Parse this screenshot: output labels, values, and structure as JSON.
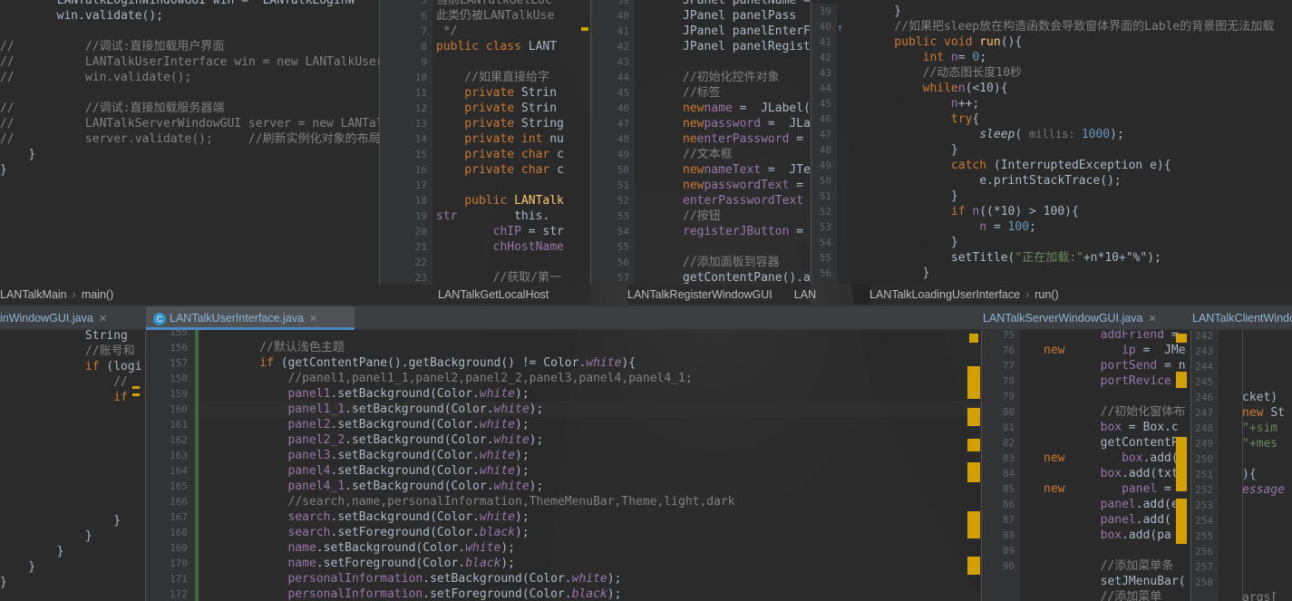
{
  "colors": {
    "bg": "#2b2b2b",
    "keyword": "#cc7832",
    "string": "#6a8759",
    "comment": "#808080",
    "field": "#9876aa",
    "number": "#6897bb",
    "method": "#ffc66d",
    "text": "#a9b7c6"
  },
  "pane1": {
    "lines": [
      {
        "pre": "        ",
        "c": "LANTalkLoginWindowGUI win = ",
        "k": "new",
        "r": " LANTalkLoginW"
      },
      {
        "pre": "        ",
        "c": "win.validate();"
      },
      {
        "pre": "",
        "c": ""
      },
      {
        "cm": "//          //调试:直接加载用户界面"
      },
      {
        "cm": "//          LANTalkUserInterface win = new LANTalkUserI"
      },
      {
        "cm": "//          win.validate();"
      },
      {
        "pre": "",
        "c": ""
      },
      {
        "cm": "//          //调试:直接加载服务器端"
      },
      {
        "cm": "//          LANTalkServerWindowGUI server = new LANTalk"
      },
      {
        "cm": "//          server.validate();     //刷新实例化对象的布局"
      },
      {
        "pre": "    ",
        "c": "}"
      },
      {
        "pre": "",
        "c": "}"
      }
    ],
    "crumb": [
      "LANTalkMain",
      "main()"
    ]
  },
  "pane2": {
    "numbers": [
      "5",
      "6",
      "7",
      "8",
      "9",
      "10",
      "11",
      "12",
      "13",
      "14",
      "15",
      "16",
      "17",
      "18",
      "19",
      "20",
      "21",
      "22",
      "23"
    ],
    "lines": [
      {
        "cm": "当前LANTalkGetLoc"
      },
      {
        "cm": "此类仍被LANTalkUse"
      },
      {
        "cm": " */"
      },
      {
        "kw": "public class ",
        "c": "LANT"
      },
      {
        "c": ""
      },
      {
        "cm": "    //如果直接给字"
      },
      {
        "kw": "    private ",
        "c": "Strin"
      },
      {
        "kw": "    private ",
        "c": "Strin"
      },
      {
        "kw": "    private ",
        "c": "String"
      },
      {
        "kw": "    private int ",
        "c": "nu"
      },
      {
        "kw": "    private char ",
        "c": "c"
      },
      {
        "kw": "    private char ",
        "c": "c"
      },
      {
        "c": ""
      },
      {
        "kw": "    public ",
        "fn": "LANTalk"
      },
      {
        "c": "        this.",
        "fld": "str"
      },
      {
        "fld": "        chIP",
        "c": " = str"
      },
      {
        "fld": "        chHostName"
      },
      {
        "c": ""
      },
      {
        "cm": "        //获取/第一"
      }
    ],
    "crumb": [
      "LANTalkGetLocalHost"
    ]
  },
  "pane3": {
    "numbers": [
      "39",
      "40",
      "41",
      "42",
      "43",
      "44",
      "45",
      "46",
      "47",
      "48",
      "49",
      "50",
      "51",
      "52",
      "53",
      "54",
      "55",
      "56",
      "57"
    ],
    "lines": [
      {
        "c": "JPanel panelName = "
      },
      {
        "c": "JPanel panelPass"
      },
      {
        "c": "JPanel panelEnterF"
      },
      {
        "c": "JPanel panelRegist"
      },
      {
        "c": ""
      },
      {
        "cm": "//初始化控件对象"
      },
      {
        "cm": "//标签"
      },
      {
        "fld": "name",
        "c": " = ",
        "kw": "new",
        "r": " JLabel("
      },
      {
        "fld": "password",
        "c": " = ",
        "kw": "new",
        "r": " JLa"
      },
      {
        "fld": "enterPassword",
        "c": " = ",
        "kw": "ne"
      },
      {
        "cm": "//文本框"
      },
      {
        "fld": "nameText",
        "c": " = ",
        "kw": "new",
        "r": " JTe"
      },
      {
        "fld": "passwordText",
        "c": " = ",
        "kw": "new"
      },
      {
        "fld": "enterPasswordText"
      },
      {
        "cm": "//按钮"
      },
      {
        "fld": "registerJButton",
        "c": " = "
      },
      {
        "c": ""
      },
      {
        "cm": "//添加面板到容器"
      },
      {
        "c": "getContentPane().a"
      }
    ],
    "crumb": [
      "LANTalkRegisterWindowGUI",
      "LAN"
    ]
  },
  "pane4": {
    "numbers": [
      "39",
      "40",
      "41",
      "42",
      "43",
      "44",
      "45",
      "46",
      "47",
      "48",
      "49",
      "50",
      "51",
      "52",
      "53",
      "54",
      "55",
      "56"
    ],
    "lines": [
      {
        "c": "    }"
      },
      {
        "cm": "    //如果把sleep放在构造函数会导致窗体界面的Lable的背景图无法加载"
      },
      {
        "kw": "    public void ",
        "fn": "run",
        "c": "(){"
      },
      {
        "kw": "        int ",
        "fld": "n",
        "c": "= ",
        "num": "0",
        "e": ";"
      },
      {
        "cm": "        //动态图长度10秒"
      },
      {
        "kw": "        while",
        "c": "(",
        "fld": "n",
        "e": "<10){"
      },
      {
        "fld": "            n",
        "c": "++;"
      },
      {
        "kw": "            try",
        "c": "{"
      },
      {
        "it": "                sleep",
        "c": "( ",
        "hint": "millis: ",
        "num": "1000",
        "e": ");"
      },
      {
        "c": "            }"
      },
      {
        "kw": "            catch ",
        "c": "(InterruptedException e){"
      },
      {
        "c": "                e.printStackTrace();"
      },
      {
        "c": "            }"
      },
      {
        "kw": "            if ",
        "c": "((",
        "fld": "n",
        "e": "*10) > 100){"
      },
      {
        "fld": "                n",
        "c": " = ",
        "num": "100",
        "e": ";"
      },
      {
        "c": "            }"
      },
      {
        "c": "            setTitle(",
        "str": "\"正在加载:\"",
        "e": "+n*10+\"%\");"
      },
      {
        "c": "        }"
      }
    ],
    "crumb": [
      "LANTalkLoadingUserInterface",
      "run()"
    ]
  },
  "tabs": [
    {
      "label": "inWindowGUI.java"
    },
    {
      "label": "LANTalkUserInterface.java"
    },
    {
      "label": "LANTalkServerWindowGUI.java"
    },
    {
      "label": "LANTalkClientWindo"
    }
  ],
  "pane5": {
    "lines": [
      {
        "c": "            String"
      },
      {
        "cm": "            //账号和"
      },
      {
        "kw": "            if ",
        "c": "(logi"
      },
      {
        "cm": "                //"
      },
      {
        "kw": "                if"
      },
      {
        "c": ""
      },
      {
        "c": ""
      },
      {
        "c": ""
      },
      {
        "c": ""
      },
      {
        "c": ""
      },
      {
        "c": ""
      },
      {
        "c": ""
      },
      {
        "c": "                }"
      },
      {
        "c": "            }"
      },
      {
        "c": "        }"
      },
      {
        "c": "    }"
      },
      {
        "c": "}"
      }
    ]
  },
  "pane6": {
    "numbers": [
      "155",
      "156",
      "157",
      "158",
      "159",
      "160",
      "161",
      "162",
      "163",
      "164",
      "165",
      "166",
      "167",
      "168",
      "169",
      "170",
      "171",
      "172"
    ],
    "lines": [
      {
        "c": ""
      },
      {
        "cm": "                //默认浅色主题"
      },
      {
        "kw": "                if ",
        "c": "(getContentPane().getBackground() != Color.",
        "fi": "white",
        "e": "){"
      },
      {
        "cm": "                    //panel1,panel1_1,panel2,panel2_2,panel3,panel4,panel4_1;"
      },
      {
        "fld": "                    panel1",
        "c": ".setBackground(Color.",
        "fi": "white",
        "e": ");"
      },
      {
        "fld": "                    panel1_1",
        "c": ".setBackground(Color.",
        "fi": "white",
        "e": ");"
      },
      {
        "fld": "                    panel2",
        "c": ".setBackground(Color.",
        "fi": "white",
        "e": ");"
      },
      {
        "fld": "                    panel2_2",
        "c": ".setBackground(Color.",
        "fi": "white",
        "e": ");"
      },
      {
        "fld": "                    panel3",
        "c": ".setBackground(Color.",
        "fi": "white",
        "e": ");"
      },
      {
        "fld": "                    panel4",
        "c": ".setBackground(Color.",
        "fi": "white",
        "e": ");"
      },
      {
        "fld": "                    panel4_1",
        "c": ".setBackground(Color.",
        "fi": "white",
        "e": ");"
      },
      {
        "cm": "                    //search,name,personalInformation,ThemeMenuBar,Theme,light,dark"
      },
      {
        "fld": "                    search",
        "c": ".setBackground(Color.",
        "fi": "white",
        "e": ");"
      },
      {
        "fld": "                    search",
        "c": ".setForeground(Color.",
        "fi": "black",
        "e": ");"
      },
      {
        "fld": "                    name",
        "c": ".setBackground(Color.",
        "fi": "white",
        "e": ");"
      },
      {
        "fld": "                    name",
        "c": ".setForeground(Color.",
        "fi": "black",
        "e": ");"
      },
      {
        "fld": "                    personalInformation",
        "c": ".setBackground(Color.",
        "fi": "white",
        "e": ");"
      },
      {
        "fld": "                    personalInformation",
        "c": ".setForeground(Color.",
        "fi": "black",
        "e": ");"
      }
    ]
  },
  "pane7": {
    "numbers": [
      "75",
      "76",
      "77",
      "78",
      "79",
      "80",
      "81",
      "82",
      "83",
      "84",
      "85",
      "86",
      "87",
      "88",
      "89",
      "90"
    ],
    "lines": [
      {
        "fld": "        addFriend",
        "c": " ="
      },
      {
        "fld": "        ip",
        "c": " = ",
        "kw": "new",
        "r": " JMe"
      },
      {
        "fld": "        portSend",
        "c": " = n"
      },
      {
        "fld": "        portRevice"
      },
      {
        "c": ""
      },
      {
        "cm": "        //初始化窗体布"
      },
      {
        "fld": "        box",
        "c": " = Box.c"
      },
      {
        "c": "        getContentP"
      },
      {
        "fld": "        box",
        "c": ".add(",
        "kw": "new"
      },
      {
        "fld": "        box",
        "c": ".add(txt)"
      },
      {
        "fld": "        panel",
        "c": " = ",
        "kw": "new"
      },
      {
        "fld": "        panel",
        "c": ".add(en"
      },
      {
        "fld": "        panel",
        "c": ".add("
      },
      {
        "fld": "        box",
        "c": ".add(pa"
      },
      {
        "c": ""
      },
      {
        "cm": "        //添加菜单条"
      },
      {
        "c": "        setJMenuBar("
      },
      {
        "cm": "        //添加菜单"
      }
    ]
  },
  "pane8": {
    "numbers": [
      "242",
      "243",
      "244",
      "245",
      "246",
      "247",
      "248",
      "249",
      "250",
      "251",
      "252",
      "253",
      "254",
      "255",
      "256",
      "257",
      "258"
    ],
    "lines": [
      {
        "c": ""
      },
      {
        "c": ""
      },
      {
        "c": ""
      },
      {
        "c": ""
      },
      {
        "c": "cket)"
      },
      {
        "kw": "new ",
        "c": "St"
      },
      {
        "str": "\"+sim"
      },
      {
        "str": "\"+mes"
      },
      {
        "c": ""
      },
      {
        "c": "){"
      },
      {
        "fi": "essage"
      },
      {
        "c": ""
      },
      {
        "c": ""
      },
      {
        "c": ""
      },
      {
        "c": ""
      },
      {
        "c": ""
      },
      {
        "c": ""
      },
      {
        "gy": "args["
      }
    ]
  }
}
